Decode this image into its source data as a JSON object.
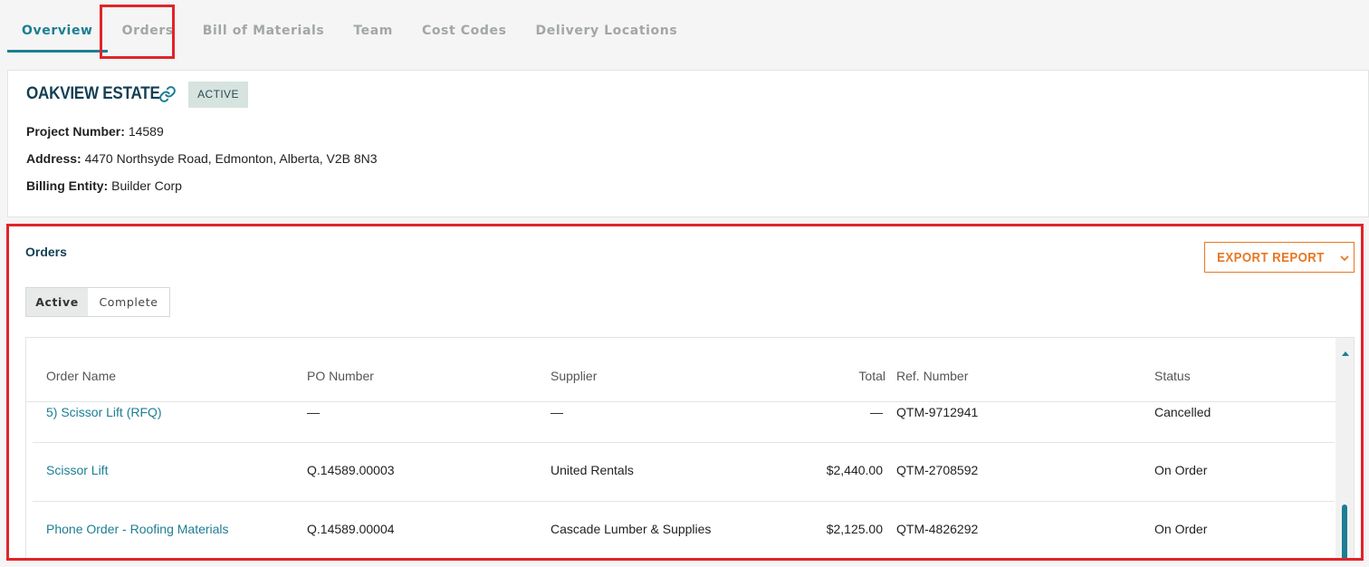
{
  "tabs": [
    {
      "label": "Overview"
    },
    {
      "label": "Orders"
    },
    {
      "label": "Bill of Materials"
    },
    {
      "label": "Team"
    },
    {
      "label": "Cost Codes"
    },
    {
      "label": "Delivery Locations"
    }
  ],
  "project": {
    "name": "OAKVIEW ESTATE",
    "status": "ACTIVE",
    "number_label": "Project Number:",
    "number": "14589",
    "address_label": "Address:",
    "address": "4470 Northsyde Road, Edmonton, Alberta, V2B 8N3",
    "billing_label": "Billing Entity:",
    "billing": "Builder Corp"
  },
  "orders": {
    "title": "Orders",
    "export_label": "EXPORT REPORT",
    "toggle": {
      "active": "Active",
      "complete": "Complete"
    },
    "columns": [
      "Order Name",
      "PO Number",
      "Supplier",
      "Total",
      "Ref. Number",
      "Status"
    ],
    "rows": [
      {
        "name": "5) Scissor Lift (RFQ)",
        "po": "—",
        "supplier": "—",
        "total": "—",
        "ref": "QTM-9712941",
        "status": "Cancelled"
      },
      {
        "name": "Scissor Lift",
        "po": "Q.14589.00003",
        "supplier": "United Rentals",
        "total": "$2,440.00",
        "ref": "QTM-2708592",
        "status": "On Order"
      },
      {
        "name": "Phone Order - Roofing Materials",
        "po": "Q.14589.00004",
        "supplier": "Cascade Lumber & Supplies",
        "total": "$2,125.00",
        "ref": "QTM-4826292",
        "status": "On Order"
      }
    ]
  },
  "colors": {
    "accent": "#1c7e94",
    "export": "#e87722",
    "highlight": "#e0242a",
    "title": "#133f53"
  }
}
